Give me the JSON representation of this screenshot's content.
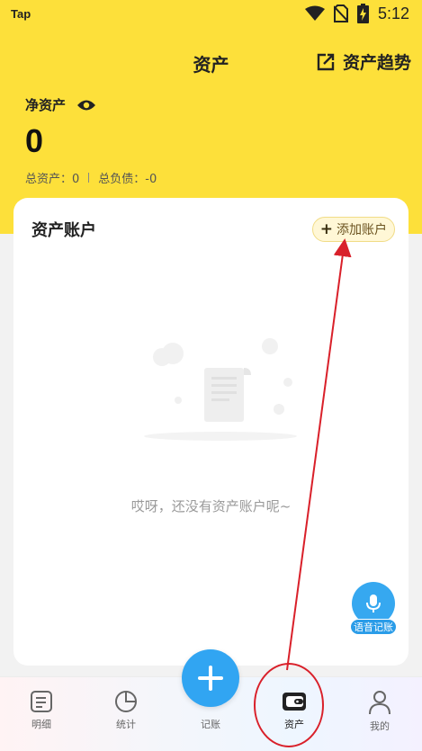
{
  "status_bar": {
    "carrier_logo": "Tap",
    "time": "5:12",
    "icons": [
      "wifi-icon",
      "no-sim-icon",
      "battery-charging-icon"
    ]
  },
  "header": {
    "title": "资产",
    "trend_label": "资产趋势"
  },
  "summary": {
    "net_assets_label": "净资产",
    "net_assets_value": "0",
    "total_assets": "总资产：0",
    "total_liabilities": "总负债：-0"
  },
  "accounts_card": {
    "title": "资产账户",
    "add_button_label": "添加账户",
    "empty_text": "哎呀，还没有资产账户呢~"
  },
  "voice_button": {
    "label": "语音记账"
  },
  "tabbar": {
    "tabs": [
      {
        "label": "明细",
        "icon": "list-icon"
      },
      {
        "label": "统计",
        "icon": "pie-chart-icon"
      },
      {
        "label": "记账",
        "icon": "plus-icon"
      },
      {
        "label": "资产",
        "icon": "wallet-icon",
        "active": true
      },
      {
        "label": "我的",
        "icon": "profile-icon"
      }
    ]
  },
  "colors": {
    "header_yellow": "#fde03a",
    "fab_blue": "#31a5f2",
    "annotation_red": "#d9202a"
  }
}
